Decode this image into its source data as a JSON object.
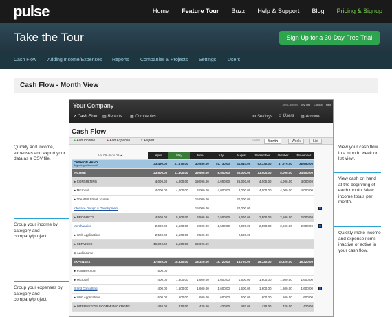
{
  "brand": {
    "logo": "pulse"
  },
  "topnav": {
    "items": [
      "Home",
      "Feature Tour",
      "Buzz",
      "Help & Support",
      "Blog",
      "Pricing & Signup"
    ]
  },
  "hero": {
    "title": "Take the Tour",
    "signup": "Sign Up for a 30-Day Free Trial"
  },
  "subnav": {
    "items": [
      "Cash Flow",
      "Adding Income/Expenses",
      "Reports",
      "Companies & Projects",
      "Settings",
      "Users"
    ]
  },
  "page": {
    "heading": "Cash Flow - Month View"
  },
  "app": {
    "title": "Your Company",
    "user": "Jim Caldwell",
    "user_links": [
      "My Info",
      "Logout",
      "Help"
    ],
    "tabs": [
      "Cash Flow",
      "Reports",
      "Companies"
    ],
    "right_tabs": [
      "Settings",
      "Users",
      "Account"
    ],
    "section_title": "Cash Flow",
    "toolbar": {
      "add_income": "Add Income",
      "add_expense": "Add Expense",
      "export": "Export",
      "view_label": "View",
      "views": [
        "Month",
        "Week",
        "List"
      ]
    },
    "date_range": "Apr 09 - Nov 09",
    "months": [
      "April",
      "May",
      "June",
      "July",
      "August",
      "September",
      "October",
      "November"
    ],
    "rows": [
      {
        "type": "cash",
        "label": "CASH ON HAND",
        "sub": "Beginning of the month",
        "values": [
          "33,490.00",
          "37,370.00",
          "30,550.00",
          "51,730.00",
          "41,510.00",
          "52,130.00",
          "47,970.00",
          "38,650.00"
        ]
      },
      {
        "type": "section",
        "label": "INCOME",
        "values": [
          "23,500.00",
          "11,500.00",
          "39,500.00",
          "8,500.00",
          "30,000.00",
          "13,500.00",
          "8,000.00",
          "34,500.00"
        ]
      },
      {
        "type": "cat",
        "label": "CONSULTING",
        "values": [
          "4,000.00",
          "4,000.00",
          "19,000.00",
          "4,000.00",
          "25,000.00",
          "4,000.00",
          "4,000.00",
          "4,000.00"
        ]
      },
      {
        "type": "sub",
        "label": "Microsoft",
        "values": [
          "4,000.00",
          "4,000.00",
          "4,000.00",
          "4,000.00",
          "4,000.00",
          "4,000.00",
          "4,000.00",
          "4,000.00"
        ]
      },
      {
        "type": "sub",
        "label": "The Wall Street Journal",
        "values": [
          "",
          "",
          "15,000.00",
          "",
          "20,000.00",
          "",
          "",
          ""
        ]
      },
      {
        "type": "link",
        "label": "Interface Design & Development",
        "values": [
          "",
          "",
          "15,000.00",
          "",
          "20,000.00",
          "",
          "",
          ""
        ]
      },
      {
        "type": "cat",
        "label": "PRODUCTS",
        "values": [
          "4,500.00",
          "5,000.00",
          "4,500.00",
          "2,500.00",
          "5,000.00",
          "2,500.00",
          "2,500.00",
          "2,000.00"
        ]
      },
      {
        "type": "link",
        "label": "Merchandise",
        "values": [
          "2,000.00",
          "2,500.00",
          "2,000.00",
          "2,500.00",
          "2,000.00",
          "2,500.00",
          "2,500.00",
          "2,000.00"
        ]
      },
      {
        "type": "sub",
        "label": "Web Applications",
        "values": [
          "2,500.00",
          "2,500.00",
          "2,500.00",
          "",
          "2,500.00",
          "",
          "",
          ""
        ]
      },
      {
        "type": "cat",
        "label": "SERVICES",
        "values": [
          "15,000.00",
          "2,500.00",
          "16,000.00",
          "",
          "",
          "",
          "",
          ""
        ]
      },
      {
        "type": "add",
        "label": "Add income",
        "values": [
          "",
          "",
          "",
          "",
          "",
          "",
          "",
          ""
        ]
      },
      {
        "type": "section",
        "label": "EXPENSES",
        "values": [
          "17,620.00",
          "18,320.00",
          "18,320.00",
          "18,720.00",
          "18,720.00",
          "18,320.00",
          "18,320.00",
          "18,320.00"
        ]
      },
      {
        "type": "sub",
        "label": "Foxnews.com",
        "values": [
          "500.00",
          "",
          "",
          "",
          "",
          "",
          "",
          ""
        ]
      },
      {
        "type": "sub",
        "label": "Microsoft",
        "values": [
          "400.00",
          "1,600.00",
          "1,600.00",
          "1,600.00",
          "1,600.00",
          "1,600.00",
          "1,600.00",
          "1,600.00"
        ]
      },
      {
        "type": "link",
        "label": "Brand Consulting",
        "values": [
          "400.00",
          "1,600.00",
          "1,600.00",
          "1,600.00",
          "1,600.00",
          "1,600.00",
          "1,600.00",
          "1,600.00"
        ]
      },
      {
        "type": "sub",
        "label": "Web Applications",
        "values": [
          "600.00",
          "600.00",
          "600.00",
          "600.00",
          "600.00",
          "600.00",
          "600.00",
          "600.00"
        ]
      },
      {
        "type": "cat",
        "label": "INTERNET/TELECOMMUNICATIONS",
        "values": [
          "420.00",
          "420.00",
          "420.00",
          "420.00",
          "420.00",
          "420.00",
          "420.00",
          "420.00"
        ]
      }
    ]
  },
  "callouts": {
    "left": [
      "Quickly add income, expenses and export your data as a CSV file.",
      "Group your income by category and company/project.",
      "Group your expenses by category and company/project."
    ],
    "right": [
      "View your cash flow in a month, week or list view.",
      "View cash on hand at the beginning of each month. View income totals per month.",
      "Quickly make income and expense items inactive or active in your cash flow."
    ]
  }
}
